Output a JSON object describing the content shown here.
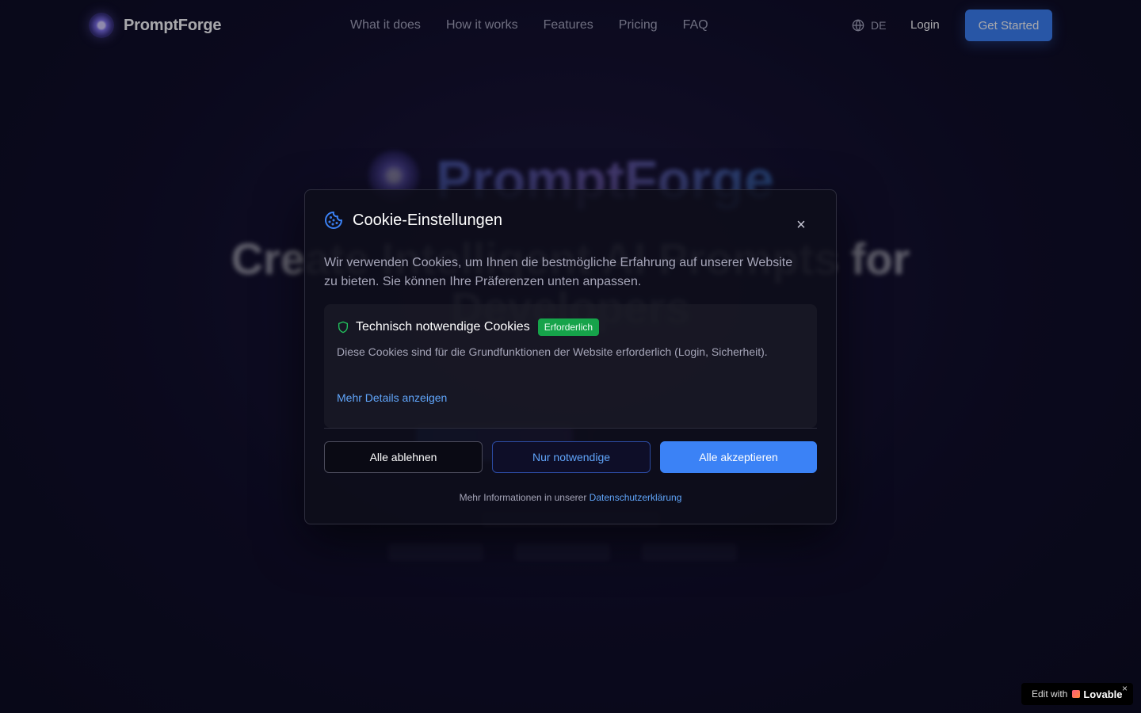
{
  "header": {
    "brand": "PromptForge",
    "nav": [
      "What it does",
      "How it works",
      "Features",
      "Pricing",
      "FAQ"
    ],
    "language": "DE",
    "login": "Login",
    "get_started": "Get Started"
  },
  "hero": {
    "brand": "PromptForge",
    "title": "Create Intelligent AI Prompts for Developers"
  },
  "cookie_modal": {
    "title": "Cookie-Einstellungen",
    "description": "Wir verwenden Cookies, um Ihnen die bestmögliche Erfahrung auf unserer Website zu bieten. Sie können Ihre Präferenzen unten anpassen.",
    "section": {
      "title": "Technisch notwendige Cookies",
      "badge": "Erforderlich",
      "description": "Diese Cookies sind für die Grundfunktionen der Website erforderlich (Login, Sicherheit).",
      "more_details": "Mehr Details anzeigen"
    },
    "buttons": {
      "reject_all": "Alle ablehnen",
      "only_necessary": "Nur notwendige",
      "accept_all": "Alle akzeptieren"
    },
    "footer_text": "Mehr Informationen in unserer",
    "privacy_link": "Datenschutzerklärung"
  },
  "lovable_badge": {
    "prefix": "Edit with",
    "brand": "Lovable"
  },
  "colors": {
    "accent": "#3b82f6",
    "link": "#60a5fa",
    "success": "#16a34a"
  }
}
